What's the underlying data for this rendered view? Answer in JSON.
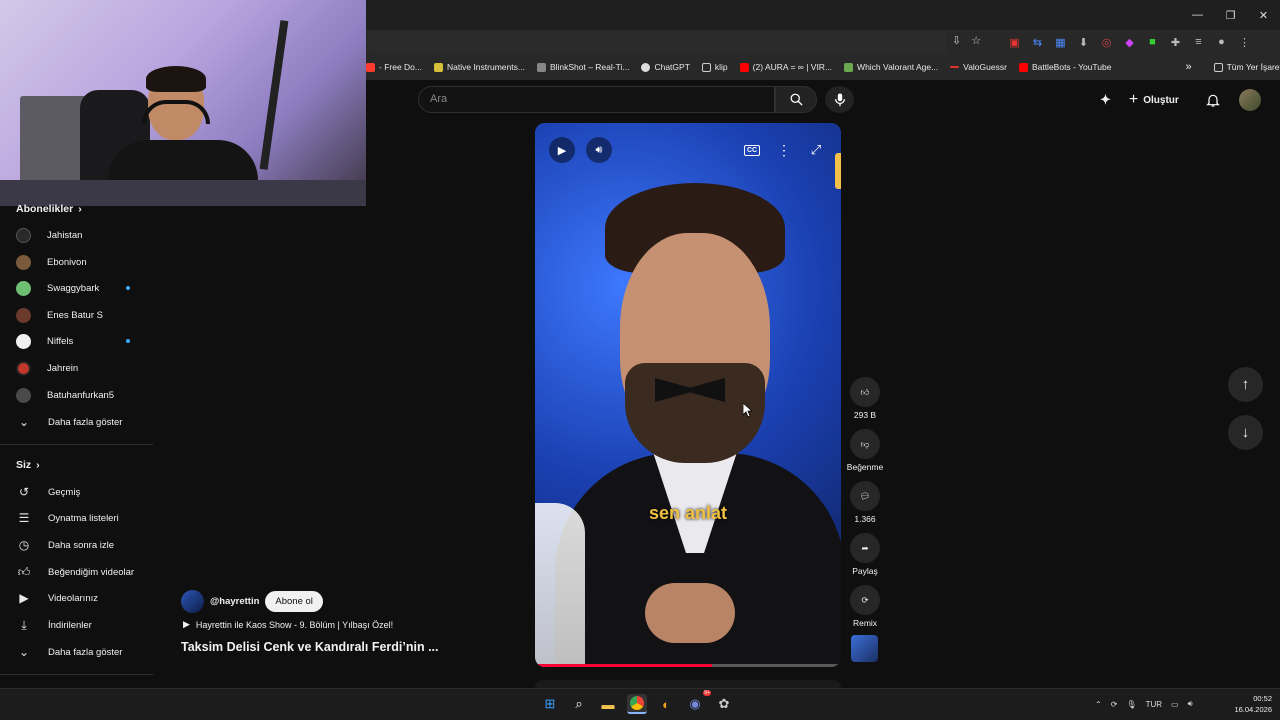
{
  "browser": {
    "bookmarks": [
      {
        "label": "- Free Do...",
        "color": "#ff3b30"
      },
      {
        "label": "Native Instruments...",
        "color": "#d6c23a"
      },
      {
        "label": "BlinkShot – Real-Ti...",
        "color": "#888888"
      },
      {
        "label": "ChatGPT",
        "color": "#dddddd"
      },
      {
        "label": "klip",
        "color": "#3a3a3a"
      },
      {
        "label": "(2) AURA = ∞ | VIR...",
        "color": "#ff0000"
      },
      {
        "label": "Which Valorant Age...",
        "color": "#6aa84f"
      },
      {
        "label": "ValoGuessr",
        "color": "#e0332f"
      },
      {
        "label": "BattleBots - YouTube",
        "color": "#ff0000"
      }
    ],
    "all_bookmarks": "Tüm Yer İşaretleri"
  },
  "header": {
    "search_placeholder": "Ara",
    "create_label": "Oluştur"
  },
  "sidebar": {
    "subscriptions_title": "Abonelikler",
    "subscriptions": [
      {
        "label": "Jahistan",
        "color": "#2a2a2a",
        "dot": false
      },
      {
        "label": "Ebonivon",
        "color": "#7a5a3a",
        "dot": false
      },
      {
        "label": "Swaggybark",
        "color": "#6fbf73",
        "dot": true
      },
      {
        "label": "Enes Batur S",
        "color": "#6b3a2c",
        "dot": false
      },
      {
        "label": "Niffels",
        "color": "#f0f0f0",
        "dot": true
      },
      {
        "label": "Jahrein",
        "color": "#c0392b",
        "dot": false
      },
      {
        "label": "Batuhanfurkan5",
        "color": "#4a4a4a",
        "dot": false
      }
    ],
    "show_more_1": "Daha fazla göster",
    "you_title": "Siz",
    "you_items": [
      {
        "label": "Geçmiş",
        "icon": "history-icon"
      },
      {
        "label": "Oynatma listeleri",
        "icon": "playlists-icon"
      },
      {
        "label": "Daha sonra izle",
        "icon": "watch-later-icon"
      },
      {
        "label": "Beğendiğim videolar",
        "icon": "liked-icon"
      },
      {
        "label": "Videolarınız",
        "icon": "your-videos-icon"
      },
      {
        "label": "İndirilenler",
        "icon": "downloads-icon"
      }
    ],
    "show_more_2": "Daha fazla göster"
  },
  "video": {
    "caption": "sen anlat",
    "progress": 0.58,
    "channel": "@hayrettin",
    "subscribe_label": "Abone ol",
    "playlist": "Hayrettin ile Kaos Show - 9. Bölüm | Yılbaşı Özel!",
    "title": "Taksim Delisi Cenk ve Kandıralı Ferdi’nin ..."
  },
  "actions": {
    "likes": "293 B",
    "dislike_label": "Beğenme",
    "comments": "1.366",
    "share_label": "Paylaş",
    "remix_label": "Remix"
  },
  "taskbar": {
    "language": "TUR",
    "time": "00:52",
    "date": "16.04.2026",
    "discord_badge": "9+"
  }
}
